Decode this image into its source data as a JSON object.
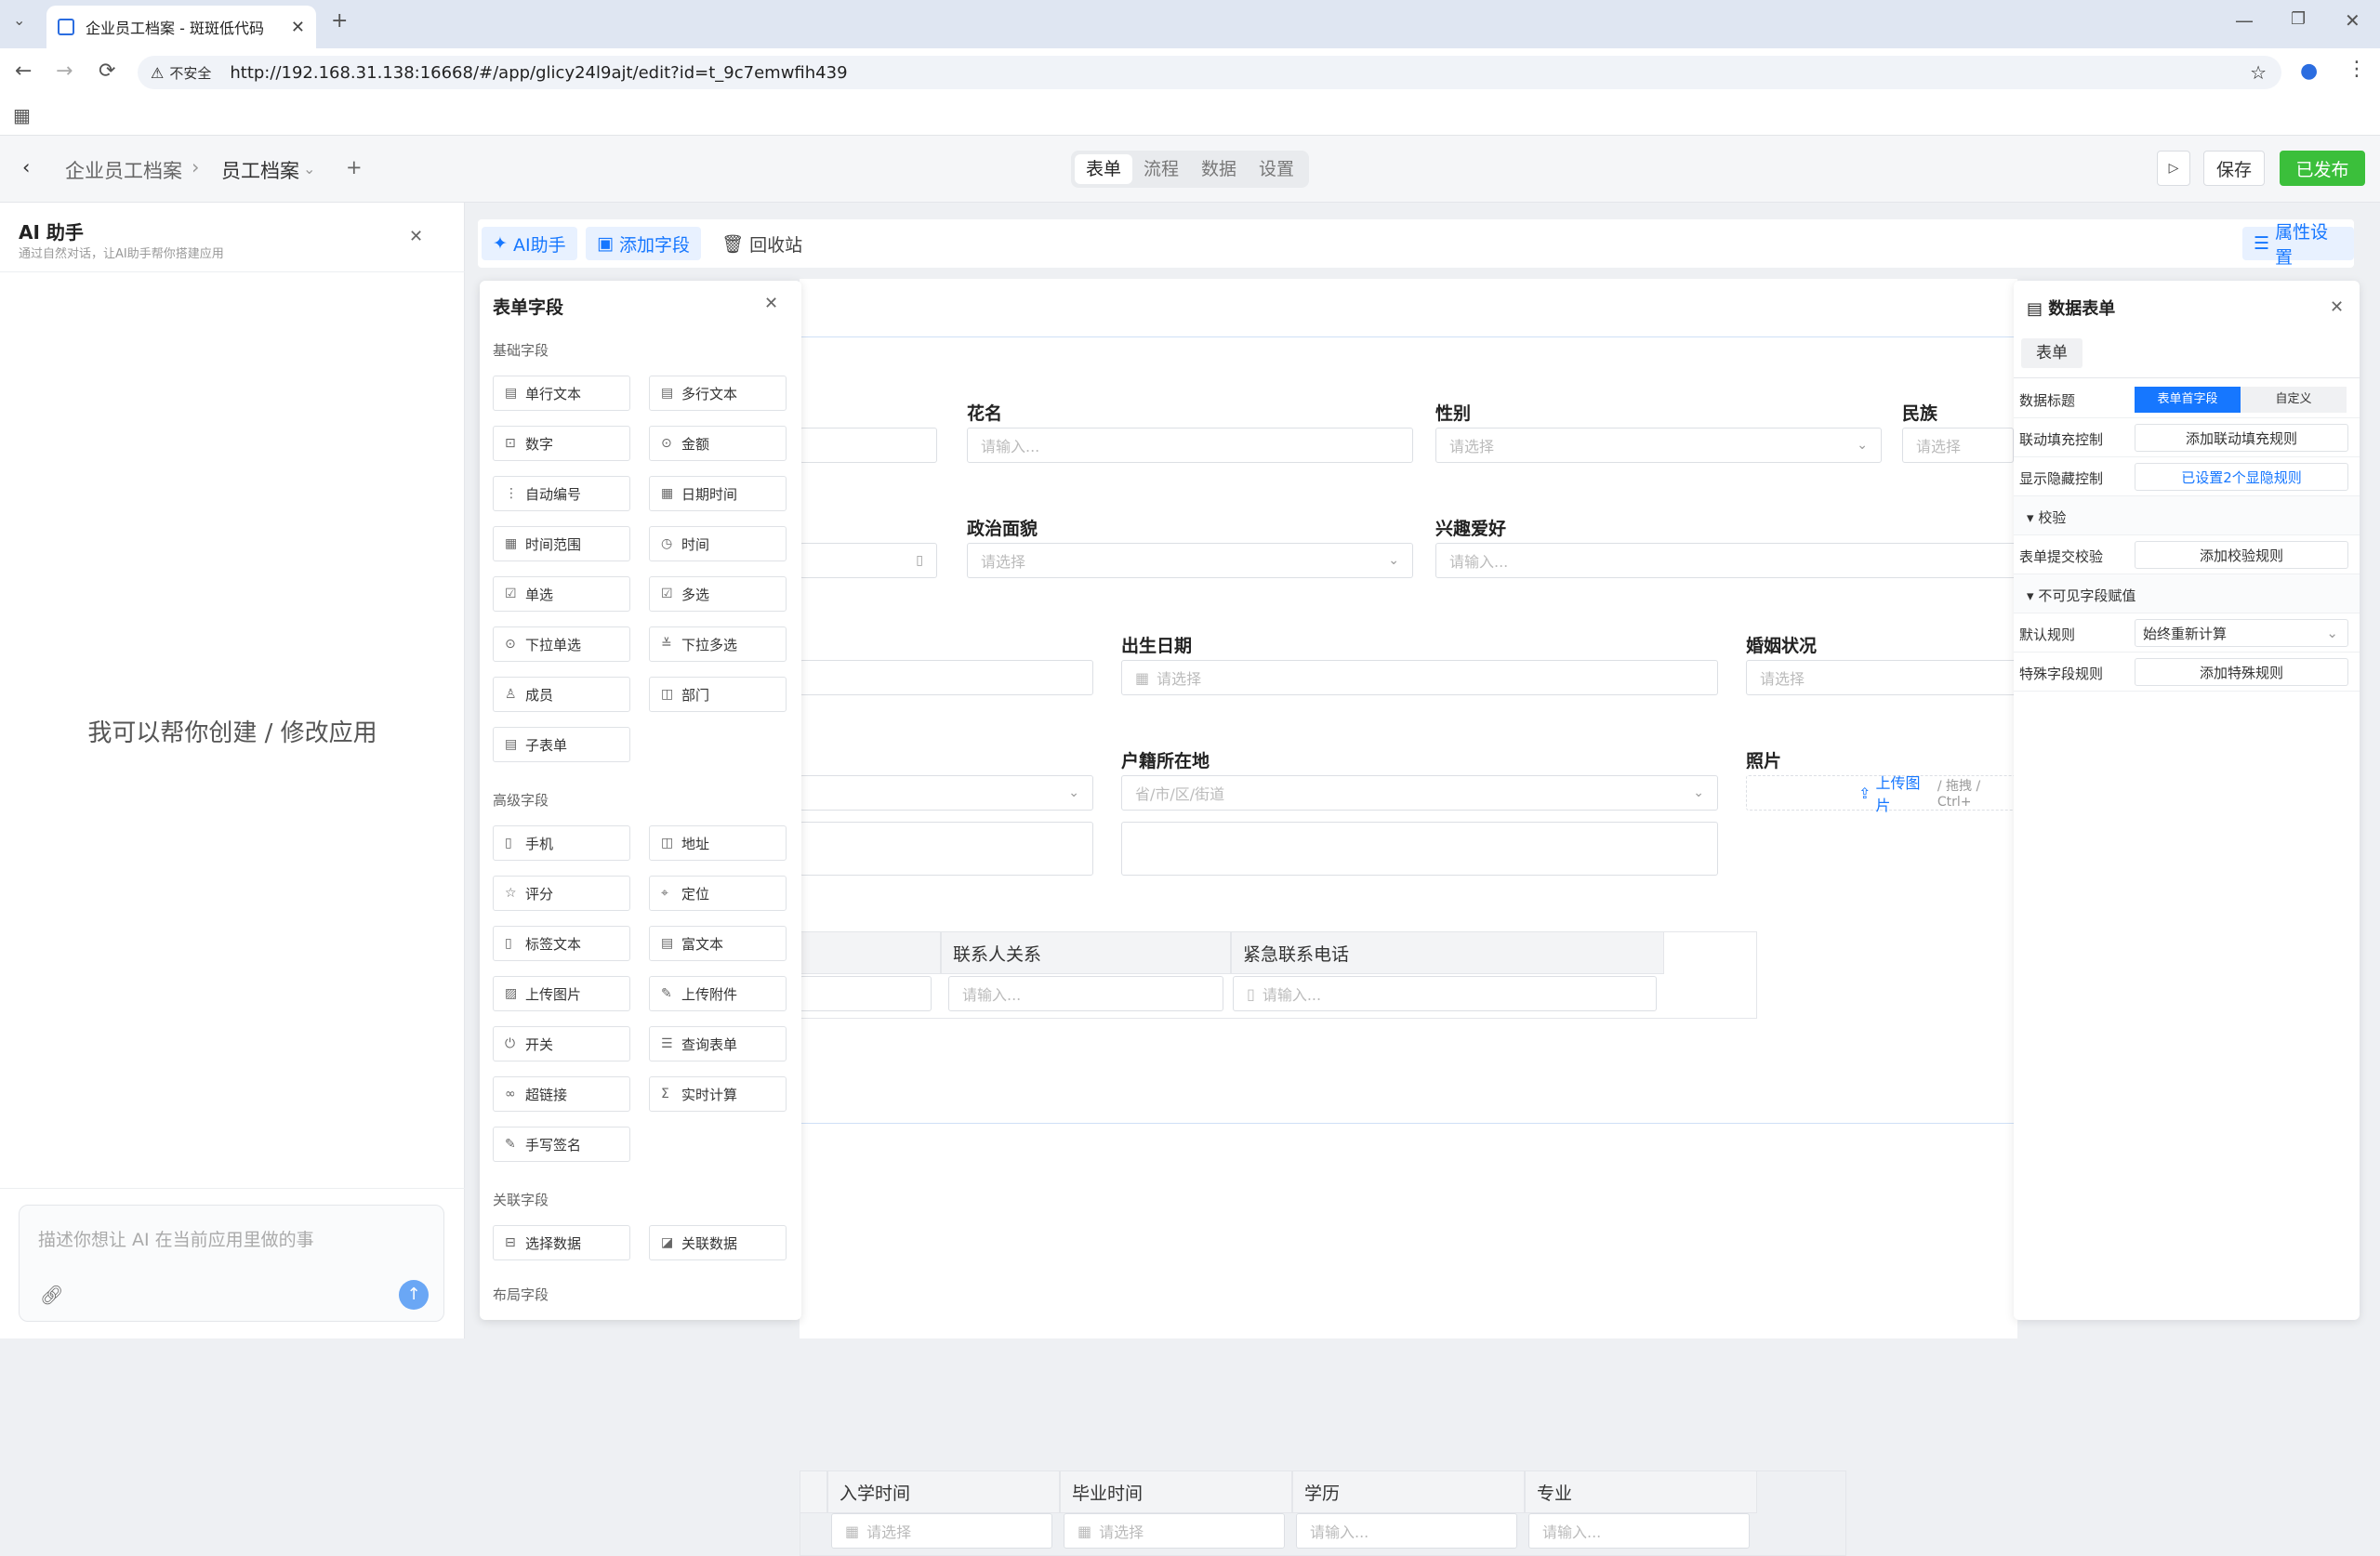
{
  "browser": {
    "tab_title": "企业员工档案 - 斑斑低代码",
    "insecure_label": "不安全",
    "url": "http://192.168.31.138:16668/#/app/glicy24l9ajt/edit?id=t_9c7emwfih439"
  },
  "header": {
    "breadcrumb_app": "企业员工档案",
    "breadcrumb_page": "员工档案",
    "tabs": [
      "表单",
      "流程",
      "数据",
      "设置"
    ],
    "active_tab": "表单",
    "save_label": "保存",
    "publish_label": "已发布",
    "publish_color": "#3bbf3b"
  },
  "ai_panel": {
    "title": "AI 助手",
    "subtitle": "通过自然对话，让AI助手帮你搭建应用",
    "hint": "我可以帮你创建 / 修改应用",
    "input_placeholder": "描述你想让 AI 在当前应用里做的事"
  },
  "toolbar": {
    "ai_label": "AI助手",
    "add_field_label": "添加字段",
    "recycle_label": "回收站",
    "props_label": "属性设置"
  },
  "field_panel": {
    "title": "表单字段",
    "basic_title": "基础字段",
    "basic": [
      "单行文本",
      "多行文本",
      "数字",
      "金额",
      "自动编号",
      "日期时间",
      "时间范围",
      "时间",
      "单选",
      "多选",
      "下拉单选",
      "下拉多选",
      "成员",
      "部门",
      "子表单"
    ],
    "advanced_title": "高级字段",
    "advanced": [
      "手机",
      "地址",
      "评分",
      "定位",
      "标签文本",
      "富文本",
      "上传图片",
      "上传附件",
      "开关",
      "查询表单",
      "超链接",
      "实时计算",
      "手写签名"
    ],
    "related_title": "关联字段",
    "related": [
      "选择数据",
      "关联数据"
    ],
    "layout_title": "布局字段"
  },
  "form": {
    "row1": {
      "nickname": "花名",
      "gender": "性别",
      "ethnicity": "民族"
    },
    "row2": {
      "politics": "政治面貌",
      "hobby": "兴趣爱好"
    },
    "row3": {
      "birthday": "出生日期",
      "marital": "婚姻状况"
    },
    "row4": {
      "hukou": "户籍所在地",
      "photo": "照片"
    },
    "placeholder_input": "请输入...",
    "placeholder_select": "请选择",
    "placeholder_region": "省/市/区/街道",
    "upload_text": "上传图片",
    "upload_tail": "/ 拖拽 / Ctrl+",
    "contact_cols": [
      "联系人关系",
      "紧急联系电话"
    ],
    "edu_cols": [
      "入学时间",
      "毕业时间",
      "学历",
      "专业"
    ]
  },
  "props_panel": {
    "title": "数据表单",
    "tab": "表单",
    "data_title_label": "数据标题",
    "data_title_opt1": "表单首字段",
    "data_title_opt2": "自定义",
    "linkage_label": "联动填充控制",
    "linkage_btn": "添加联动填充规则",
    "showhide_label": "显示隐藏控制",
    "showhide_btn": "已设置2个显隐规则",
    "validate_section": "校验",
    "submit_validate_label": "表单提交校验",
    "submit_validate_btn": "添加校验规则",
    "invisible_section": "不可见字段赋值",
    "default_rule_label": "默认规则",
    "default_rule_value": "始终重新计算",
    "special_rule_label": "特殊字段规则",
    "special_rule_btn": "添加特殊规则"
  },
  "colors": {
    "accent": "#1677ff",
    "publish": "#3bbf3b"
  }
}
